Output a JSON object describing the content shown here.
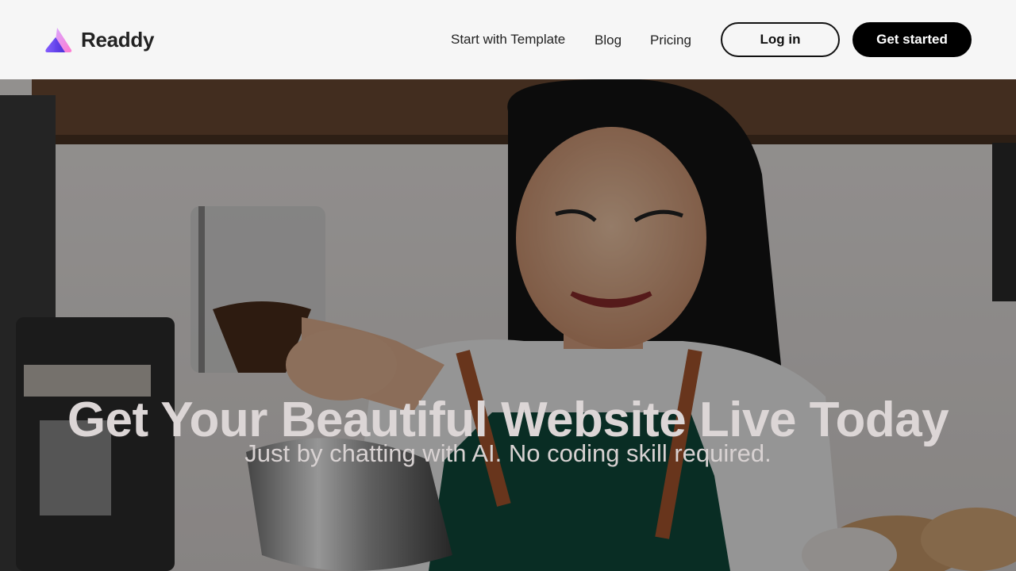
{
  "brand": {
    "name": "Readdy",
    "logo_icon": "triangle-logo-icon",
    "colors": [
      "#a06bff",
      "#ff8ad8"
    ]
  },
  "nav": {
    "links": [
      "Start with Template",
      "Blog",
      "Pricing"
    ],
    "login_label": "Log in",
    "cta_label": "Get started"
  },
  "hero": {
    "title": "Get Your Beautiful Website Live Today",
    "subtitle": "Just by chatting with AI. No coding skill required.",
    "background_image": "barista-pouring-latte-photo"
  }
}
